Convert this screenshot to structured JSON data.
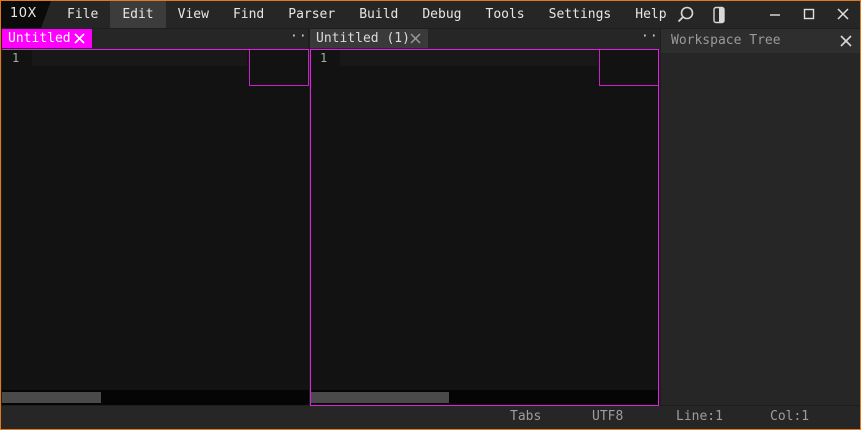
{
  "app": {
    "logo": "10X"
  },
  "menu": [
    "File",
    "Edit",
    "View",
    "Find",
    "Parser",
    "Build",
    "Debug",
    "Tools",
    "Settings",
    "Help"
  ],
  "active_menu": "Edit",
  "toolbar_icons": [
    "search-icon",
    "panel-toggle-icon"
  ],
  "window_controls": [
    "minimize-icon",
    "maximize-icon",
    "close-icon"
  ],
  "left_pane": {
    "tab_label": "Untitled",
    "line_number": "1",
    "overflow": "···",
    "scroll_position": 0,
    "active": true
  },
  "right_pane": {
    "tab_label": "Untitled (1)",
    "line_number": "1",
    "overflow": "···",
    "scroll_position": 0,
    "active": false
  },
  "workspace": {
    "title": "Workspace Tree"
  },
  "status": {
    "indent": "Tabs",
    "encoding": "UTF8",
    "line": "Line:1",
    "col": "Col:1"
  },
  "colors": {
    "accent": "#ff00ff",
    "window_border": "#e07a1f",
    "editor_bg": "#121212",
    "chrome_bg": "#262626"
  }
}
